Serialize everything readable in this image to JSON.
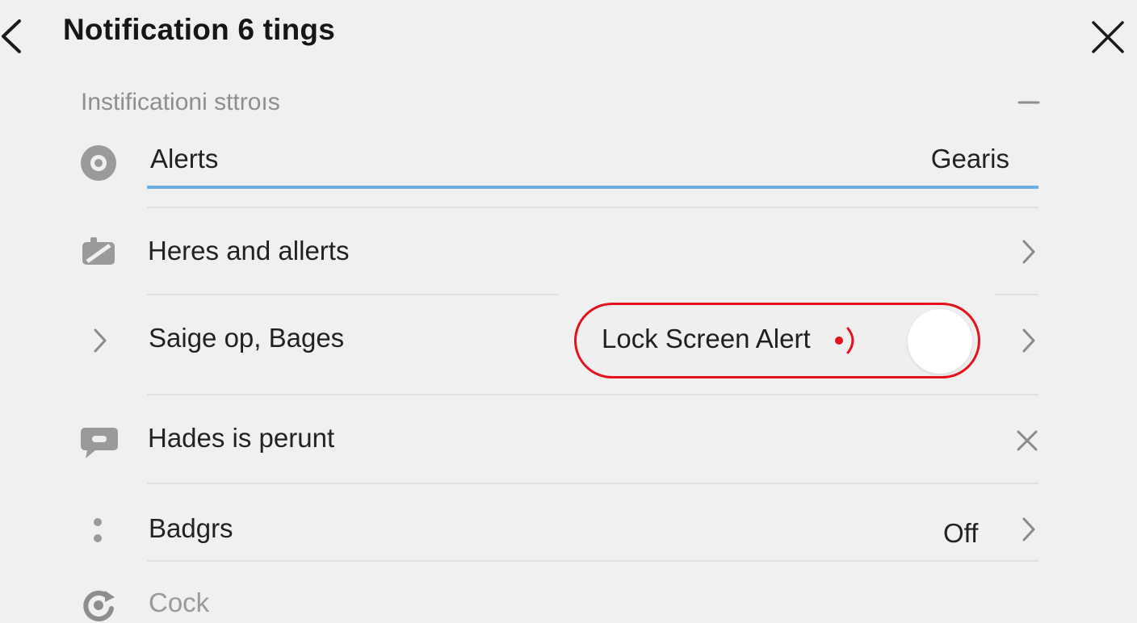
{
  "header": {
    "title": "Notification 6 tings"
  },
  "section": {
    "title": "Instificationi sttroıs"
  },
  "rows": [
    {
      "label": "Alerts",
      "value": "Gearis",
      "icon": "target-icon"
    },
    {
      "label": "Heres and allerts",
      "icon": "edit-tag-icon",
      "trailing": "chevron-right-icon"
    },
    {
      "label": "Saige op, Bages",
      "icon": "chevron-right-icon",
      "trailing": "chevron-right-icon"
    },
    {
      "label": "Hades is perunt",
      "icon": "chat-bubble-icon",
      "trailing": "close-icon"
    },
    {
      "label": "Badgrs",
      "value": "Off",
      "icon": "dots-icon",
      "trailing": "chevron-right-icon"
    },
    {
      "label": "Cock",
      "icon": "refresh-icon"
    }
  ],
  "lock_screen": {
    "label": "Lock Screen Alert",
    "icon": "sound-indicator-icon",
    "toggle_state": "off"
  },
  "colors": {
    "accent_underline": "#6aaee8",
    "highlight_outline": "#e3121c",
    "background": "#f0f0f0"
  }
}
